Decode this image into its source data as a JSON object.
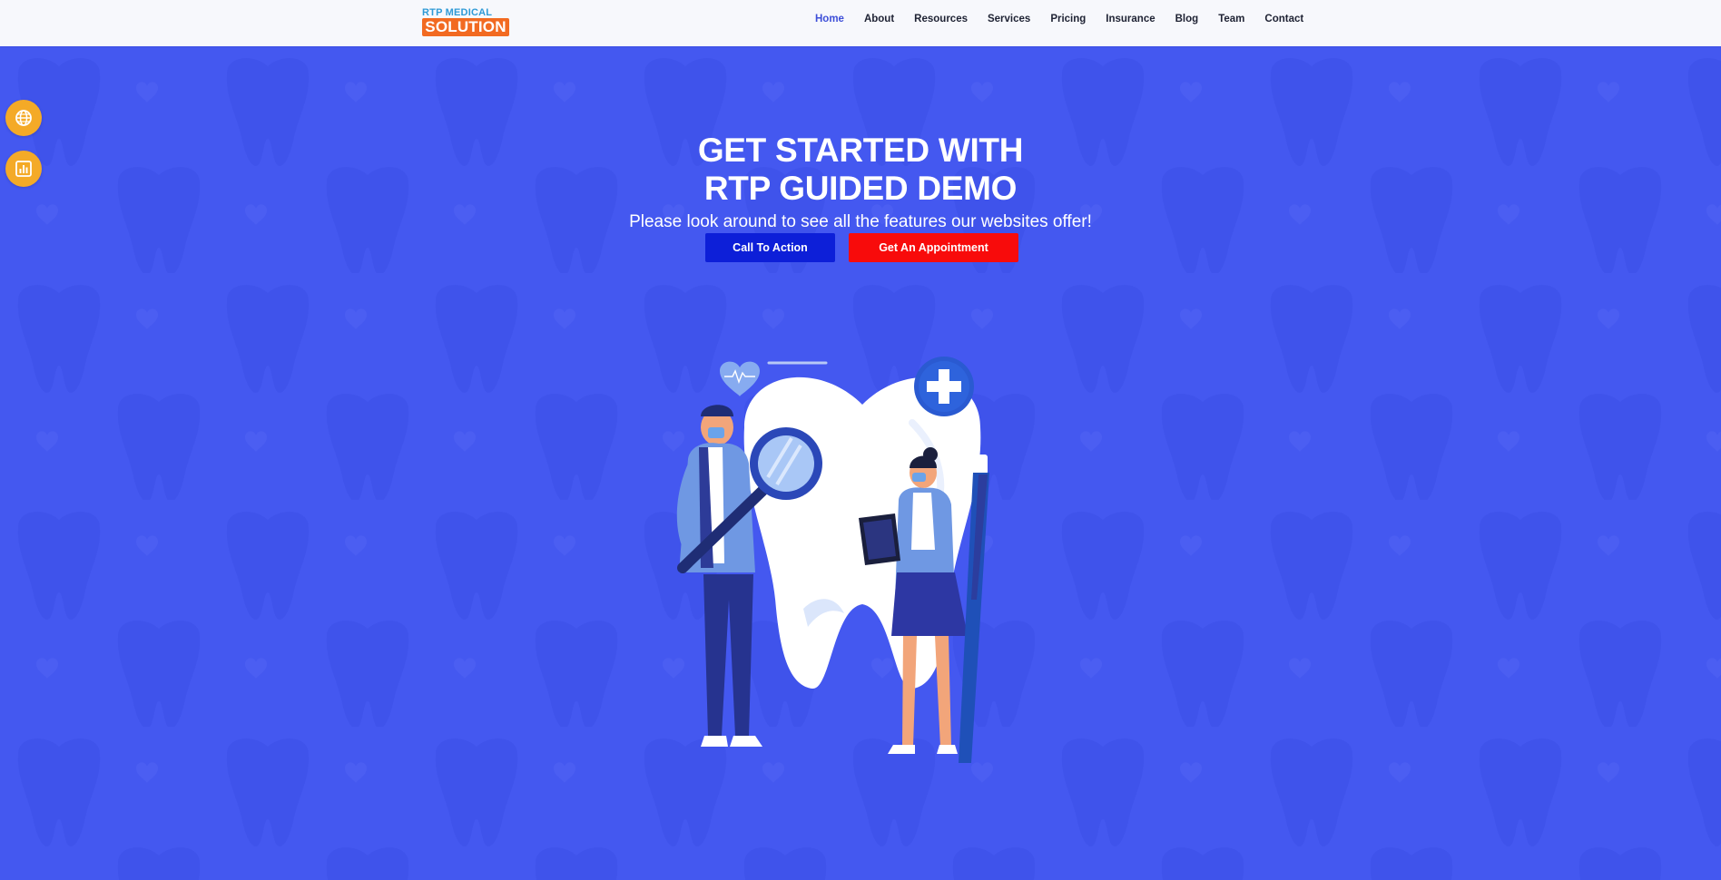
{
  "header": {
    "logo": {
      "top_text": "RTP MEDICAL",
      "bottom_text": "SOLUTION"
    },
    "nav": [
      {
        "label": "Home",
        "active": true
      },
      {
        "label": "About",
        "active": false
      },
      {
        "label": "Resources",
        "active": false
      },
      {
        "label": "Services",
        "active": false
      },
      {
        "label": "Pricing",
        "active": false
      },
      {
        "label": "Insurance",
        "active": false
      },
      {
        "label": "Blog",
        "active": false
      },
      {
        "label": "Team",
        "active": false
      },
      {
        "label": "Contact",
        "active": false
      }
    ]
  },
  "hero": {
    "title_line1": "GET STARTED WITH",
    "title_line2": "RTP GUIDED DEMO",
    "subtitle": "Please look around to see all the features our websites offer!",
    "cta_label": "Call To Action",
    "appointment_label": "Get An Appointment"
  },
  "side_buttons": [
    {
      "icon": "globe-icon"
    },
    {
      "icon": "bar-chart-icon"
    }
  ],
  "colors": {
    "hero_background": "#4458f0",
    "cta_button": "#0d1fd8",
    "appointment_button": "#f80b0b",
    "active_nav": "#3e4fd8",
    "side_button": "#f4aa27"
  }
}
